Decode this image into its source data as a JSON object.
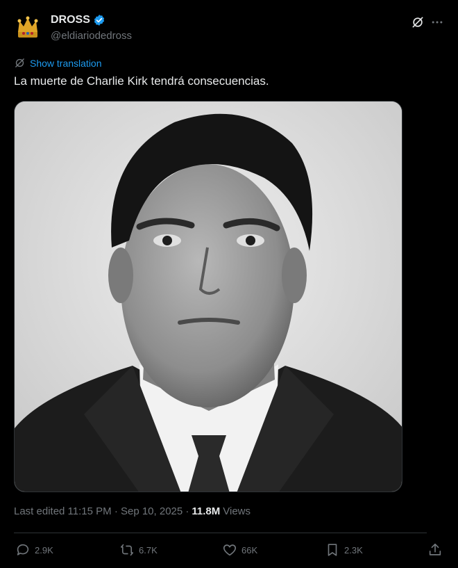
{
  "author": {
    "display_name": "DROSS",
    "handle": "@eldiariodedross",
    "verified": true,
    "avatar_icon": "crown-icon"
  },
  "translation": {
    "label": "Show translation"
  },
  "tweet": {
    "text": "La muerte de Charlie Kirk tendrá consecuencias."
  },
  "meta": {
    "edited_label": "Last edited 11:15 PM · Sep 10, 2025 ·",
    "views_count": "11.8M",
    "views_label": "Views"
  },
  "actions": {
    "replies": "2.9K",
    "reposts": "6.7K",
    "likes": "66K",
    "bookmarks": "2.3K"
  },
  "colors": {
    "background": "#000000",
    "accent": "#1d9bf0",
    "text": "#e7e9ea",
    "muted": "#71767b",
    "border": "#2f3336"
  }
}
